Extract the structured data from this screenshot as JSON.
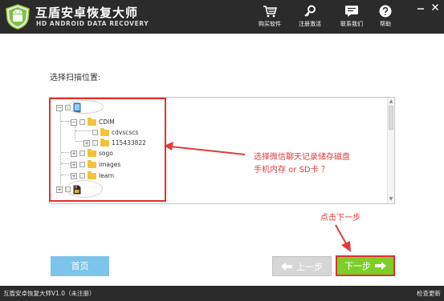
{
  "header": {
    "title": "互盾安卓恢复大师",
    "subtitle": "HD ANDROID DATA RECOVERY",
    "buttons": [
      {
        "label": "购买软件",
        "icon": "cart-icon"
      },
      {
        "label": "注册激活",
        "icon": "key-icon"
      },
      {
        "label": "联系我们",
        "icon": "chat-icon"
      },
      {
        "label": "帮助",
        "icon": "help-icon"
      }
    ]
  },
  "main": {
    "prompt": "选择扫描位置:",
    "tree": [
      {
        "label": "",
        "icon": "phone-icon",
        "expander": "−"
      },
      {
        "label": "CDIM",
        "icon": "folder-icon",
        "expander": "−"
      },
      {
        "label": "cdvscscs",
        "icon": "folder-icon",
        "expander": ""
      },
      {
        "label": "115433822",
        "icon": "folder-icon",
        "expander": "+"
      },
      {
        "label": "sogo",
        "icon": "folder-icon",
        "expander": "+"
      },
      {
        "label": "images",
        "icon": "folder-icon",
        "expander": "+"
      },
      {
        "label": "learn",
        "icon": "folder-icon",
        "expander": "+"
      },
      {
        "label": "",
        "icon": "sd-card-icon",
        "expander": "+"
      }
    ]
  },
  "annotations": {
    "storage_line1": "选择微信聊天记录储存磁盘",
    "storage_line2": "手机内存 or SD卡 ？",
    "click_next": "点击下一步"
  },
  "footer": {
    "home": "首页",
    "prev": "上一步",
    "next": "下一步"
  },
  "status": {
    "version": "互盾安卓恢复大师V1.0（未注册）",
    "check_update": "检查更新"
  },
  "colors": {
    "titlebar": "#2b2b2b",
    "accent_red": "#e23a3a",
    "next_green": "#7ccf28",
    "home_blue": "#7cc4ea"
  }
}
